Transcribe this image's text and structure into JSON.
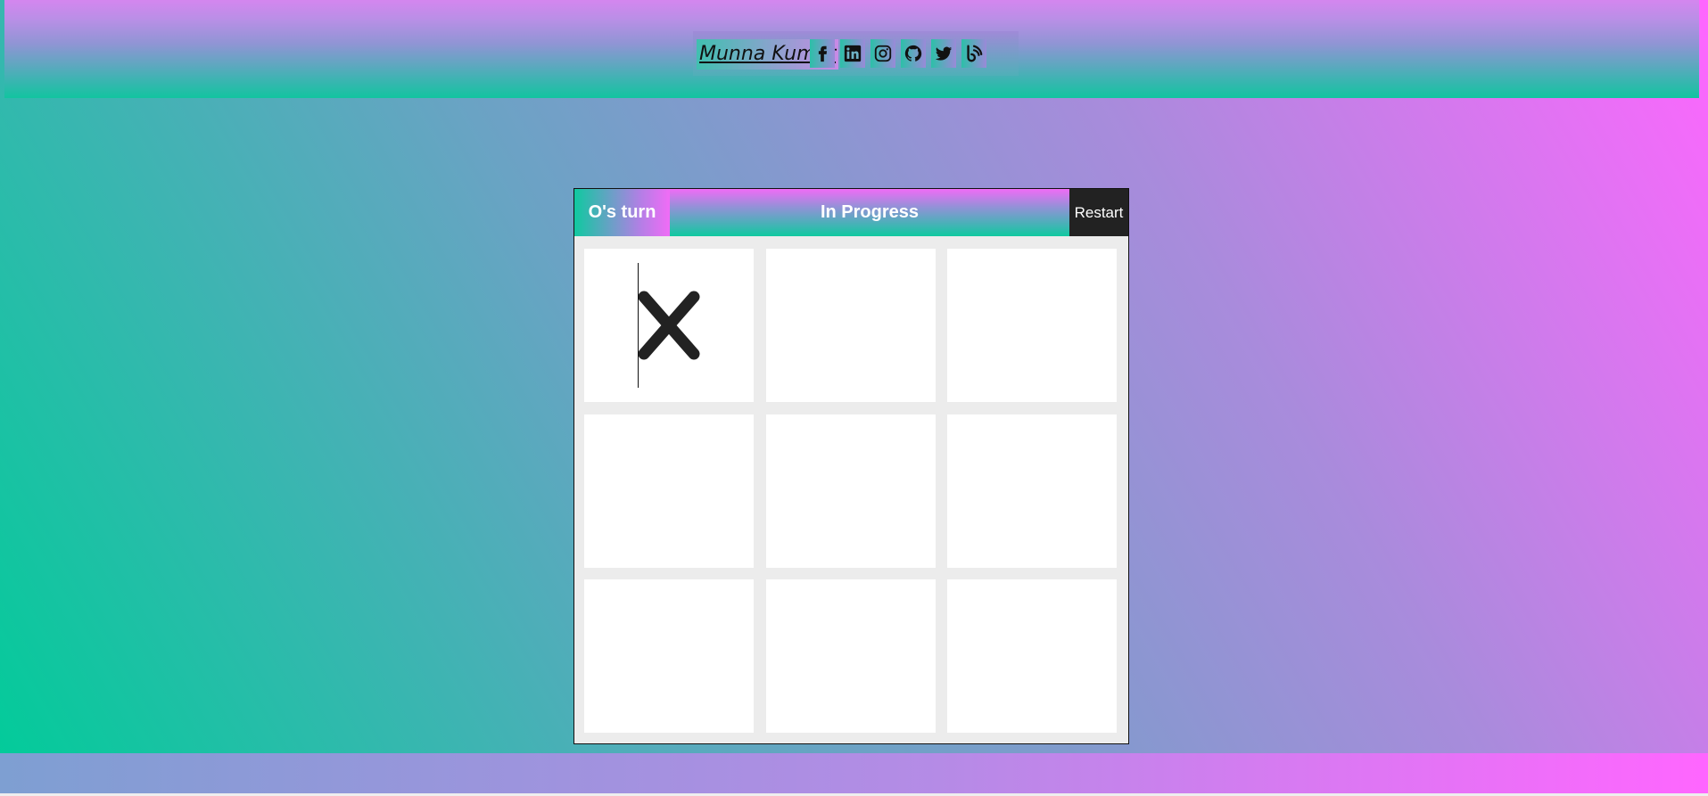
{
  "header": {
    "brand": "Munna Kumar",
    "social_icons": [
      "facebook-icon",
      "linkedin-icon",
      "instagram-icon",
      "github-icon",
      "twitter-icon",
      "blog-icon"
    ]
  },
  "game": {
    "turn": "O's turn",
    "status": "In Progress",
    "restart_label": "Restart",
    "board": [
      "X",
      "",
      "",
      "",
      "",
      "",
      "",
      "",
      ""
    ]
  },
  "colors": {
    "gradient_green": "#00cc99",
    "gradient_pink": "#ff66ff",
    "mark_color": "#222222"
  }
}
